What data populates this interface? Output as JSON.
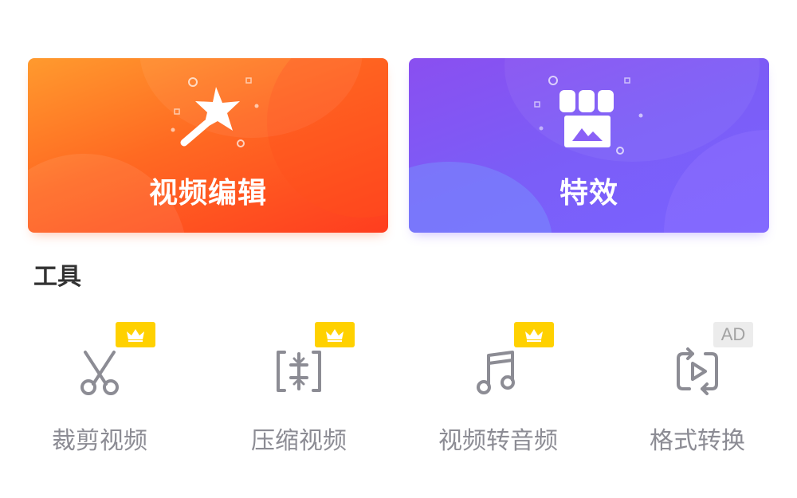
{
  "cards": [
    {
      "title": "视频编辑",
      "icon": "magic-wand-icon",
      "color": "#ff6a22"
    },
    {
      "title": "特效",
      "icon": "storefront-icon",
      "color": "#7b5df7"
    }
  ],
  "section": {
    "title": "工具"
  },
  "tools": [
    {
      "label": "裁剪视频",
      "icon": "scissors-icon",
      "badge": "vip-crown"
    },
    {
      "label": "压缩视频",
      "icon": "compress-icon",
      "badge": "vip-crown"
    },
    {
      "label": "视频转音频",
      "icon": "music-note-icon",
      "badge": "vip-crown"
    },
    {
      "label": "格式转换",
      "icon": "format-convert-icon",
      "badge": "AD"
    }
  ],
  "colors": {
    "vip_badge": "#ffd100",
    "icon_gray": "#8c8c94",
    "title_dark": "#333333"
  }
}
